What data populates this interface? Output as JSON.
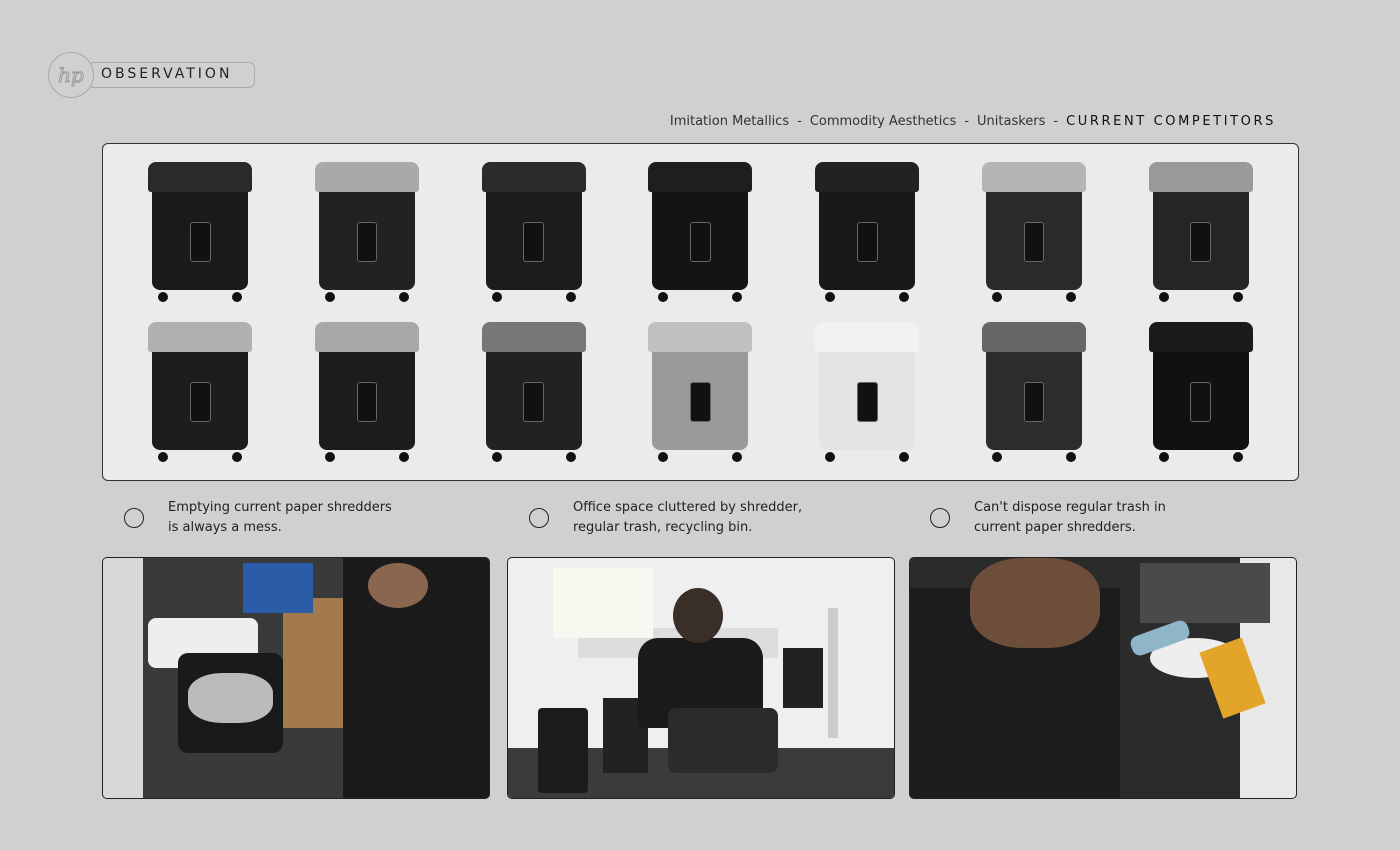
{
  "header": {
    "logo_text": "hp",
    "title": "OBSERVATION"
  },
  "breadcrumb": {
    "items": [
      "Imitation Metallics",
      "Commodity Aesthetics",
      "Unitaskers"
    ],
    "separator": "-",
    "current": "CURRENT COMPETITORS"
  },
  "competitors": [
    {
      "lid": "#2a2a2a",
      "body": "#1a1a1a"
    },
    {
      "lid": "#a9a9a9",
      "body": "#222"
    },
    {
      "lid": "#2b2b2b",
      "body": "#1c1c1c"
    },
    {
      "lid": "#1e1e1e",
      "body": "#141414"
    },
    {
      "lid": "#222",
      "body": "#181818"
    },
    {
      "lid": "#b5b5b5",
      "body": "#2a2a2a"
    },
    {
      "lid": "#999",
      "body": "#252525"
    },
    {
      "lid": "#b0b0b0",
      "body": "#1d1d1d"
    },
    {
      "lid": "#a8a8a8",
      "body": "#1c1c1c"
    },
    {
      "lid": "#777",
      "body": "#222"
    },
    {
      "lid": "#c0c0c0",
      "body": "#9a9a9a"
    },
    {
      "lid": "#f2f2f2",
      "body": "#e4e4e4"
    },
    {
      "lid": "#666",
      "body": "#2c2c2c"
    },
    {
      "lid": "#1b1b1b",
      "body": "#111"
    }
  ],
  "observations": [
    {
      "line1": "Emptying current paper shredders",
      "line2": "is always a mess."
    },
    {
      "line1": "Office space cluttered by shredder,",
      "line2": "regular trash, recycling bin."
    },
    {
      "line1": "Can't dispose regular trash in",
      "line2": "current paper shredders."
    }
  ]
}
